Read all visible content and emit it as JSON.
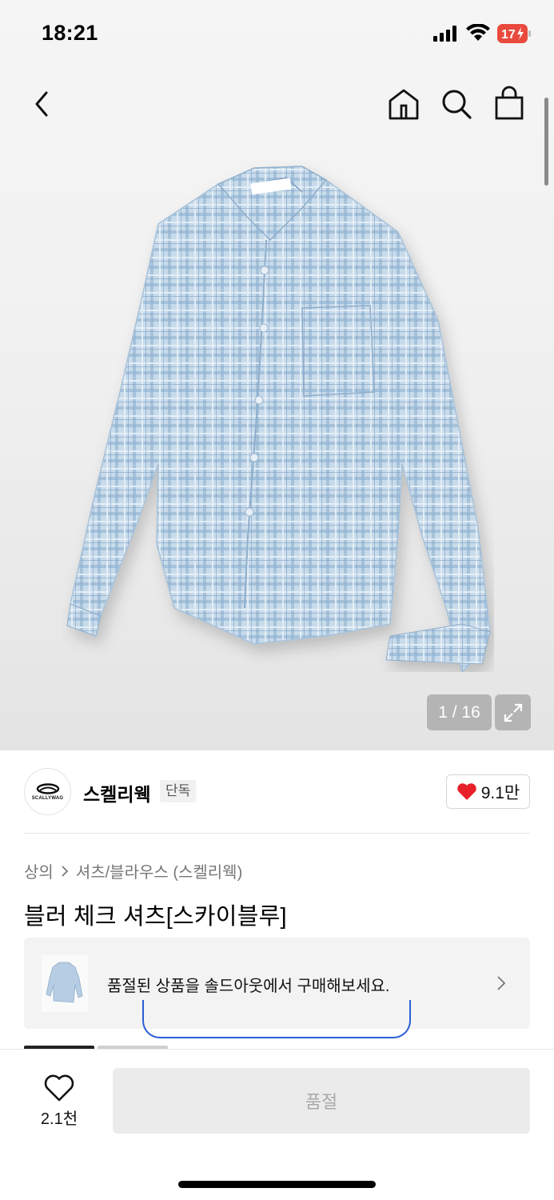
{
  "status_bar": {
    "time": "18:21",
    "battery": "17"
  },
  "gallery": {
    "counter": "1 / 16"
  },
  "brand": {
    "name": "스켈리웩",
    "badge": "단독",
    "logo_text": "SCALLYWAG",
    "likes": "9.1만"
  },
  "breadcrumb": {
    "category": "상의",
    "subcategory": "셔츠/블라우스 (스켈리웩)"
  },
  "product": {
    "title": "블러 체크 셔츠[스카이블루]"
  },
  "soldout_banner": {
    "text": "품절된 상품을 솔드아웃에서 구매해보세요."
  },
  "bottom_bar": {
    "wish_count": "2.1천",
    "button_label": "품절"
  },
  "colors": {
    "heart": "#e8202a",
    "battery": "#ea4a3f",
    "shirt": "#b9d1e6",
    "outline": "#2a5ed8"
  },
  "icons": [
    "back-icon",
    "home-icon",
    "search-icon",
    "shopping-bag-icon",
    "expand-icon",
    "heart-icon",
    "chevron-right-icon"
  ]
}
